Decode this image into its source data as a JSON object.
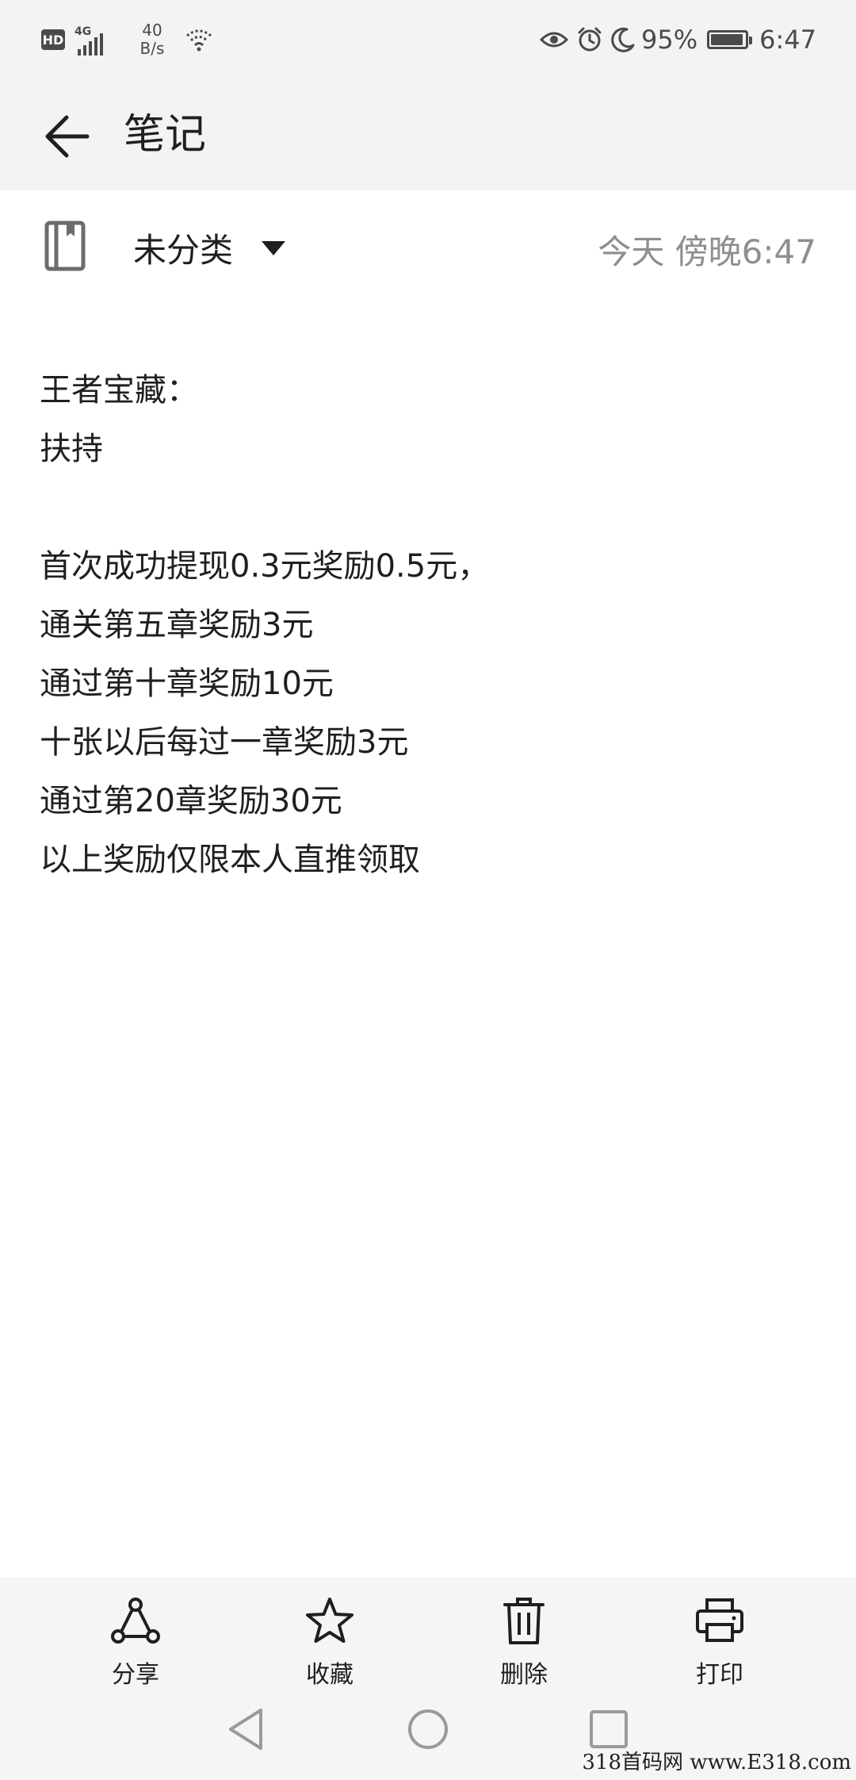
{
  "status_bar": {
    "hd": "HD",
    "network": "4G",
    "speed_value": "40",
    "speed_unit": "B/s",
    "battery_percent": "95%",
    "time": "6:47",
    "icons": [
      "hd-icon",
      "signal-4g-icon",
      "wifi-icon",
      "eye-comfort-icon",
      "alarm-icon",
      "do-not-disturb-moon-icon",
      "battery-icon"
    ]
  },
  "app_bar": {
    "title": "笔记",
    "back_icon": "arrow-left-icon"
  },
  "meta": {
    "category": "未分类",
    "timestamp": "今天 傍晚6:47"
  },
  "note": {
    "lines": [
      "王者宝藏：",
      "扶持",
      "",
      "首次成功提现0.3元奖励0.5元，",
      "通关第五章奖励3元",
      "通过第十章奖励10元",
      "十张以后每过一章奖励3元",
      "通过第20章奖励30元",
      "以上奖励仅限本人直推领取"
    ]
  },
  "actions": {
    "share": "分享",
    "favorite": "收藏",
    "delete": "删除",
    "print": "打印"
  },
  "watermark": "318首码网 www.E318.com",
  "colors": {
    "background": "#ffffff",
    "bar_background": "#f3f3f3",
    "text_primary": "#1f1f1f",
    "text_secondary": "#8e8e8e"
  }
}
